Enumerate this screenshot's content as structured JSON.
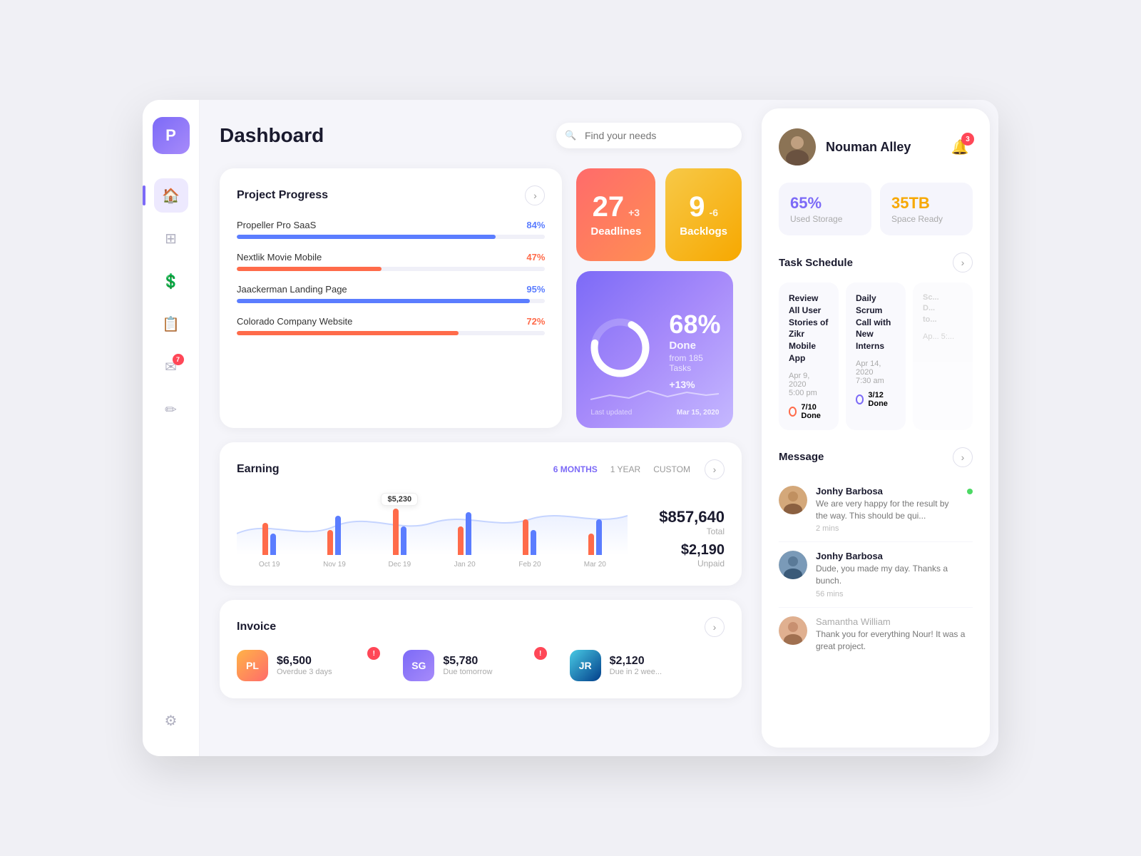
{
  "app": {
    "logo": "P",
    "title": "Dashboard"
  },
  "sidebar": {
    "items": [
      {
        "name": "home",
        "icon": "🏠",
        "active": true
      },
      {
        "name": "grid",
        "icon": "⊞",
        "active": false
      },
      {
        "name": "dollar",
        "icon": "💲",
        "active": false
      },
      {
        "name": "list",
        "icon": "📋",
        "active": false
      },
      {
        "name": "mail",
        "icon": "✉",
        "active": false,
        "badge": "7"
      },
      {
        "name": "edit",
        "icon": "✏",
        "active": false
      },
      {
        "name": "settings",
        "icon": "⚙",
        "active": false
      }
    ]
  },
  "search": {
    "placeholder": "Find your needs"
  },
  "projectProgress": {
    "title": "Project Progress",
    "items": [
      {
        "name": "Propeller Pro SaaS",
        "pct": 84,
        "color": "#5b7dff",
        "label": "84%"
      },
      {
        "name": "Nextlik Movie Mobile",
        "pct": 47,
        "color": "#ff6b4a",
        "label": "47%"
      },
      {
        "name": "Jaackerman Landing Page",
        "pct": 95,
        "color": "#5b7dff",
        "label": "95%"
      },
      {
        "name": "Colorado Company Website",
        "pct": 72,
        "color": "#ff6b4a",
        "label": "72%"
      }
    ]
  },
  "deadlines": {
    "number": "27",
    "delta": "+3",
    "label": "Deadlines"
  },
  "backlogs": {
    "number": "9",
    "delta": "-6",
    "label": "Backlogs"
  },
  "donut": {
    "pct": "68%",
    "done_label": "Done",
    "tasks_from": "from 185 Tasks",
    "delta": "+13%",
    "last_updated": "Last updated",
    "date": "Mar 15, 2020"
  },
  "earning": {
    "title": "Earning",
    "tabs": [
      "6 MONTHS",
      "1 YEAR",
      "CUSTOM"
    ],
    "active_tab": "6 MONTHS",
    "total_amount": "$857,640",
    "total_label": "Total",
    "unpaid_amount": "$2,190",
    "unpaid_label": "Unpaid",
    "tooltip": "$5,230",
    "chart_labels": [
      "Oct 19",
      "Nov 19",
      "Dec 19",
      "Jan 20",
      "Feb 20",
      "Mar 20"
    ],
    "chart_data": [
      {
        "orange": 45,
        "blue": 30
      },
      {
        "orange": 35,
        "blue": 55
      },
      {
        "orange": 65,
        "blue": 40
      },
      {
        "orange": 40,
        "blue": 60
      },
      {
        "orange": 50,
        "blue": 35
      },
      {
        "orange": 30,
        "blue": 50
      }
    ]
  },
  "invoice": {
    "title": "Invoice",
    "items": [
      {
        "initials": "PL",
        "amount": "$6,500",
        "due": "Overdue 3 days",
        "color": "#ff8c5a",
        "alert": true
      },
      {
        "initials": "SG",
        "amount": "$5,780",
        "due": "Due tomorrow",
        "color": "#7c6af7",
        "alert": true
      },
      {
        "initials": "JR",
        "amount": "$2,120",
        "due": "Due in 2 wee...",
        "color": "#48cae4",
        "alert": false
      }
    ]
  },
  "user": {
    "name": "Nouman Alley",
    "notifications": "3"
  },
  "storage": {
    "used_pct": "65%",
    "used_label": "Used Storage",
    "space_tb": "35TB",
    "space_label": "Space Ready"
  },
  "taskSchedule": {
    "title": "Task Schedule",
    "tasks": [
      {
        "name": "Review All User Stories of Zikr Mobile App",
        "date": "Apr 9, 2020",
        "time": "5:00 pm",
        "progress": "7/10 Done",
        "dot_color": "orange"
      },
      {
        "name": "Daily Scrum Call with New Interns",
        "date": "Apr 14, 2020",
        "time": "7:30 am",
        "progress": "3/12 Done",
        "dot_color": "purple"
      },
      {
        "name": "Sc... D... to...",
        "date": "Ap... 5:...",
        "time": "",
        "progress": "",
        "dot_color": "purple",
        "partial": true
      }
    ]
  },
  "messages": {
    "title": "Message",
    "items": [
      {
        "name": "Jonhy Barbosa",
        "text": "We are very happy for the result by the way. This should be qui...",
        "time": "2 mins",
        "online": true,
        "avatar_type": "photo1"
      },
      {
        "name": "Jonhy Barbosa",
        "text": "Dude, you made my day. Thanks a bunch.",
        "time": "56 mins",
        "online": false,
        "avatar_type": "photo2"
      },
      {
        "name": "Samantha William",
        "text": "Thank you for everything Nour! It was a great project.",
        "time": "",
        "online": false,
        "avatar_type": "photo3"
      }
    ]
  }
}
